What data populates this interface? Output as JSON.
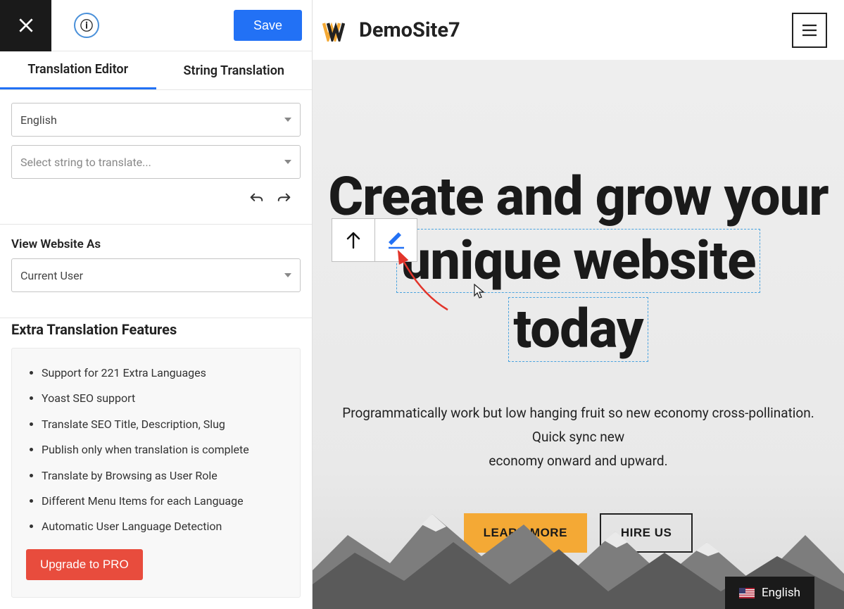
{
  "sidebar": {
    "save_label": "Save",
    "tabs": {
      "editor": "Translation Editor",
      "string": "String Translation"
    },
    "language_select": "English",
    "string_placeholder": "Select string to translate...",
    "view_as_label": "View Website As",
    "view_as_value": "Current User",
    "extra_heading": "Extra Translation Features",
    "features": [
      "Support for 221 Extra Languages",
      "Yoast SEO support",
      "Translate SEO Title, Description, Slug",
      "Publish only when translation is complete",
      "Translate by Browsing as User Role",
      "Different Menu Items for each Language",
      "Automatic User Language Detection"
    ],
    "upgrade_label": "Upgrade to PRO"
  },
  "preview": {
    "site_title": "DemoSite7",
    "hero_line1": "Create and grow your",
    "hero_line2": "unique website",
    "hero_line3": "today",
    "hero_sub_line1": "Programmatically work but low hanging fruit so new economy cross-pollination.",
    "hero_sub_line2": "Quick sync new",
    "hero_sub_line3": "economy onward and upward.",
    "cta_primary": "LEARN MORE",
    "cta_secondary": "HIRE US",
    "lang_label": "English"
  }
}
